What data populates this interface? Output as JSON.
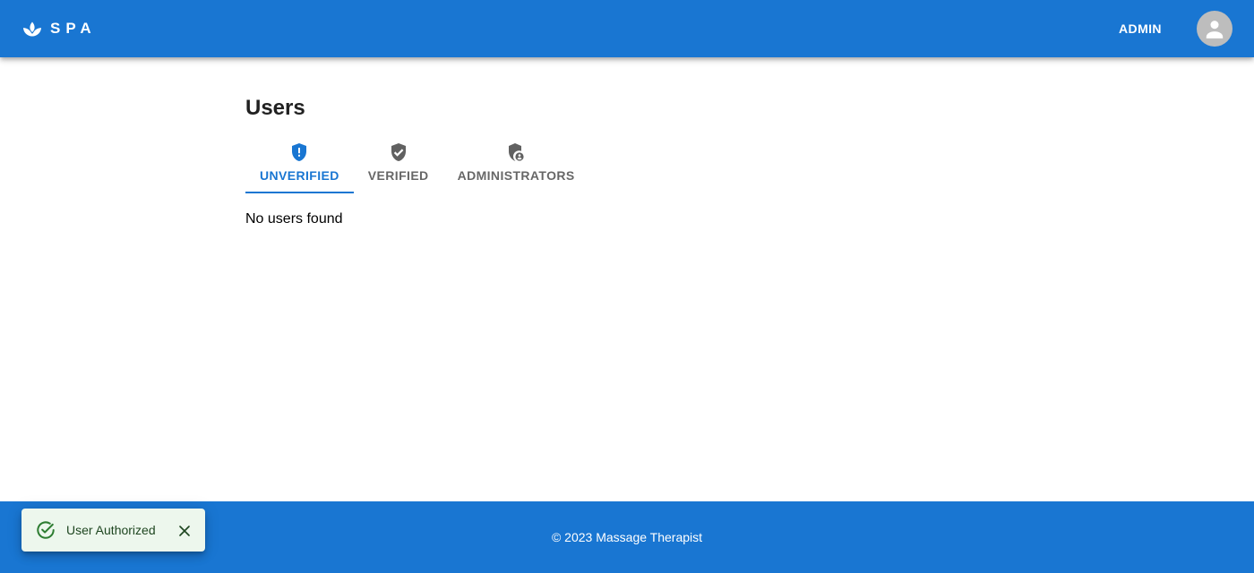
{
  "header": {
    "brand": "SPA",
    "admin_label": "ADMIN",
    "logo_icon": "lotus-icon",
    "avatar_icon": "person-icon",
    "color": "#1976d2"
  },
  "main": {
    "title": "Users",
    "tabs": [
      {
        "label": "UNVERIFIED",
        "icon": "shield-alert-icon",
        "selected": true
      },
      {
        "label": "VERIFIED",
        "icon": "shield-check-icon",
        "selected": false
      },
      {
        "label": "ADMINISTRATORS",
        "icon": "admin-shield-icon",
        "selected": false
      }
    ],
    "empty_message": "No users found"
  },
  "footer": {
    "text": "© 2023 Massage Therapist"
  },
  "snackbar": {
    "message": "User Authorized",
    "severity": "success",
    "icon": "check-circle-icon",
    "close_icon": "close-icon"
  }
}
